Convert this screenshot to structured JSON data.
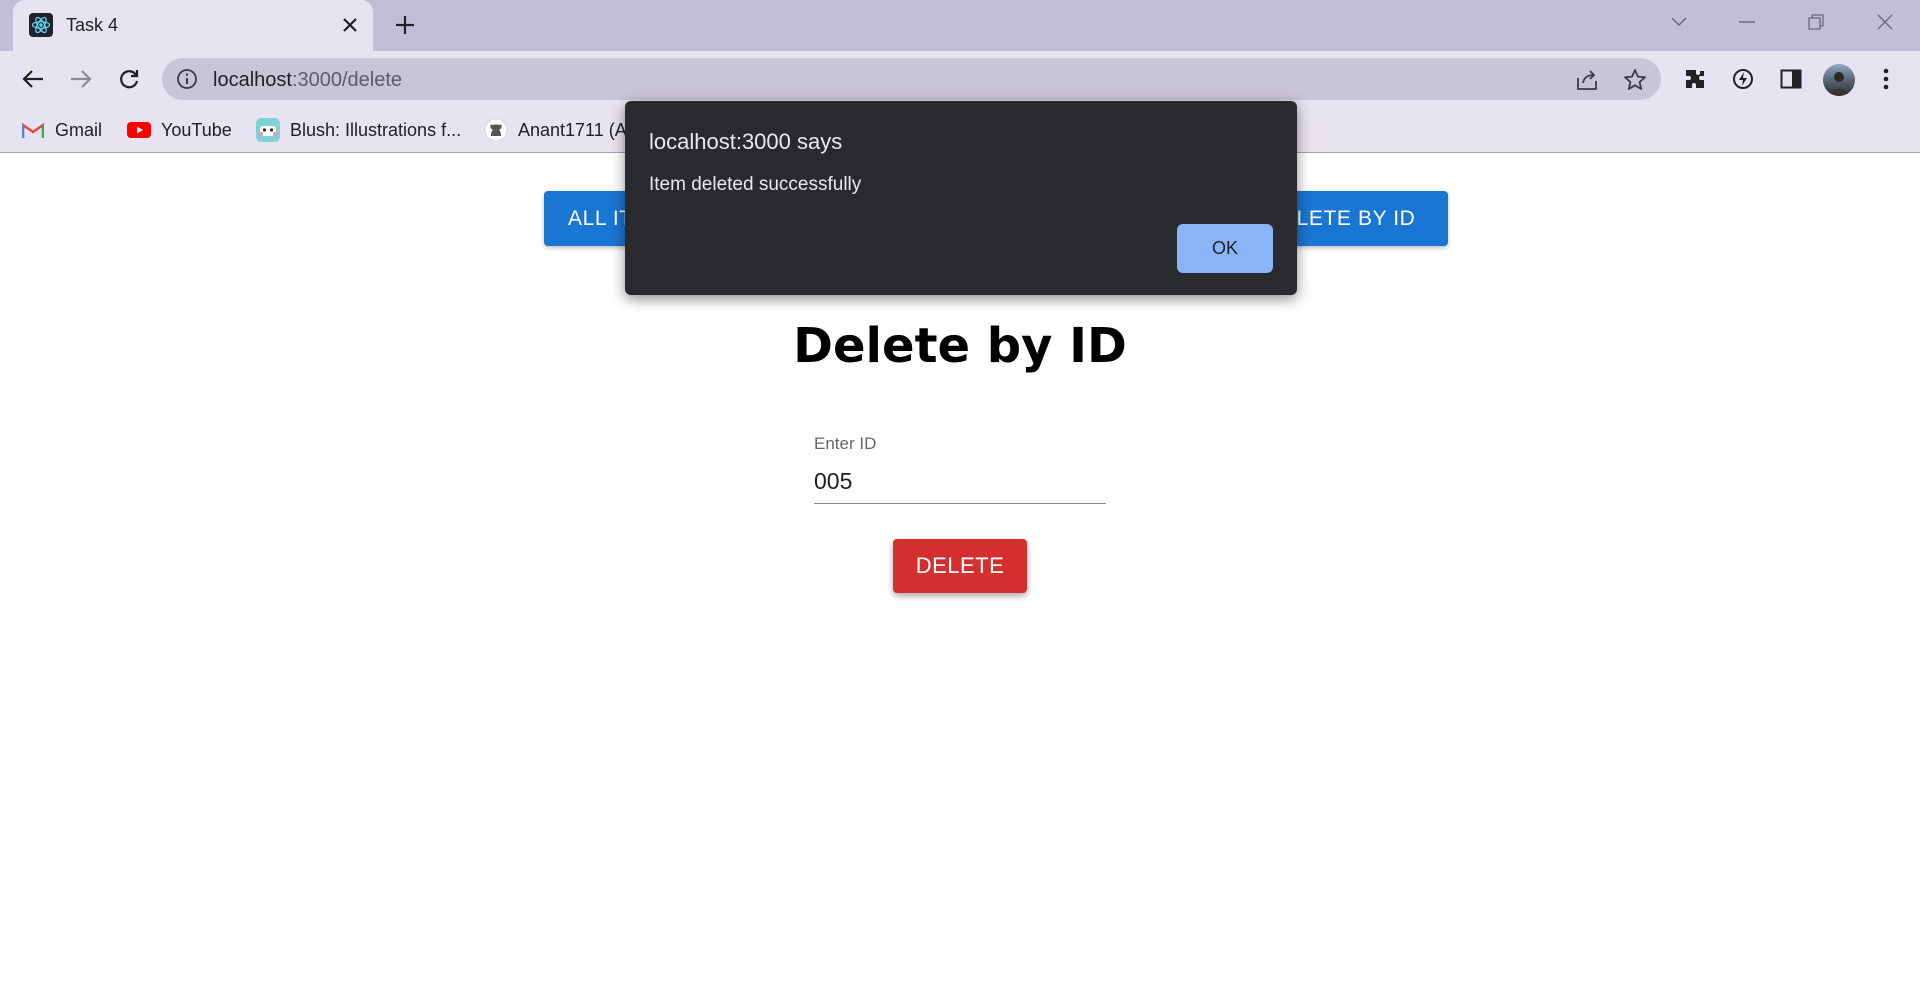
{
  "browser": {
    "tab": {
      "title": "Task 4",
      "favicon": "react-icon"
    },
    "address_bar": {
      "host": "localhost",
      "path": ":3000/delete"
    },
    "bookmarks": [
      {
        "label": "Gmail",
        "icon": "gmail-icon"
      },
      {
        "label": "YouTube",
        "icon": "youtube-icon"
      },
      {
        "label": "Blush: Illustrations f...",
        "icon": "blush-icon"
      },
      {
        "label": "Anant1711 (A",
        "icon": "github-icon"
      }
    ]
  },
  "page": {
    "nav_buttons": {
      "all_items": "ALL IT",
      "delete_by_id": "ELETE BY ID"
    },
    "title": "Delete by ID",
    "field": {
      "label": "Enter ID",
      "value": "005"
    },
    "delete_button": "DELETE"
  },
  "dialog": {
    "title": "localhost:3000 says",
    "message": "Item deleted successfully",
    "ok_label": "OK"
  },
  "colors": {
    "primary_blue": "#1976d2",
    "danger_red": "#d32f2f",
    "dialog_bg": "#292a2d",
    "dialog_button": "#8ab4f8"
  }
}
